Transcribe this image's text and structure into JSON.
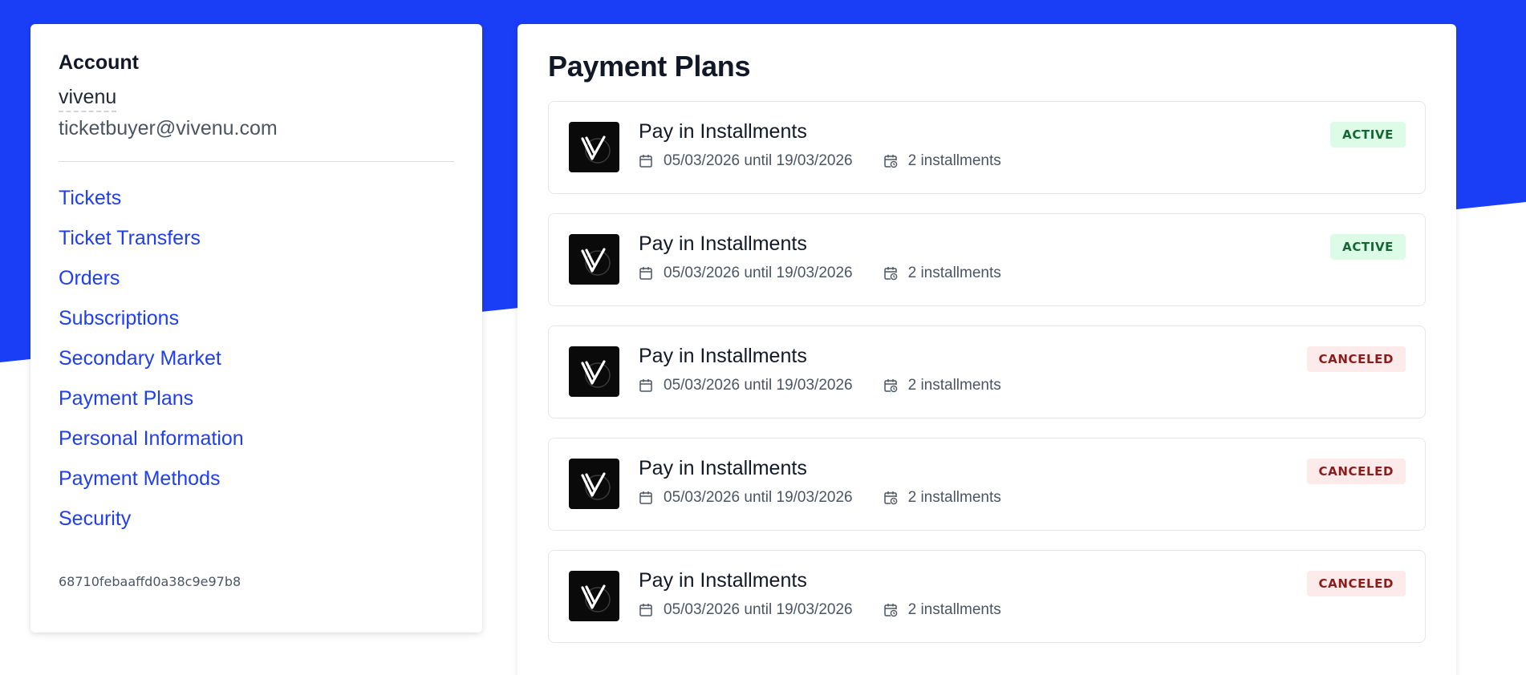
{
  "colors": {
    "brand_blue": "#1a3ef6",
    "link": "#1f3ef0",
    "active_bg": "#dcfce7",
    "active_text": "#166534",
    "canceled_bg": "#fdeaea",
    "canceled_text": "#8b1c1c"
  },
  "account": {
    "heading": "Account",
    "name": "vivenu",
    "email": "ticketbuyer@vivenu.com",
    "nav": [
      {
        "label": "Tickets"
      },
      {
        "label": "Ticket Transfers"
      },
      {
        "label": "Orders"
      },
      {
        "label": "Subscriptions"
      },
      {
        "label": "Secondary Market"
      },
      {
        "label": "Payment Plans"
      },
      {
        "label": "Personal Information"
      },
      {
        "label": "Payment Methods"
      },
      {
        "label": "Security"
      }
    ],
    "user_id": "68710febaaffd0a38c9e97b8"
  },
  "payment_plans": {
    "title": "Payment Plans",
    "plans": [
      {
        "name": "Pay in Installments",
        "dates": "05/03/2026 until 19/03/2026",
        "installments": "2 installments",
        "status": "ACTIVE",
        "status_type": "active"
      },
      {
        "name": "Pay in Installments",
        "dates": "05/03/2026 until 19/03/2026",
        "installments": "2 installments",
        "status": "ACTIVE",
        "status_type": "active"
      },
      {
        "name": "Pay in Installments",
        "dates": "05/03/2026 until 19/03/2026",
        "installments": "2 installments",
        "status": "CANCELED",
        "status_type": "canceled"
      },
      {
        "name": "Pay in Installments",
        "dates": "05/03/2026 until 19/03/2026",
        "installments": "2 installments",
        "status": "CANCELED",
        "status_type": "canceled"
      },
      {
        "name": "Pay in Installments",
        "dates": "05/03/2026 until 19/03/2026",
        "installments": "2 installments",
        "status": "CANCELED",
        "status_type": "canceled"
      }
    ],
    "icons": {
      "date": "calendar-icon",
      "installments": "calendar-clock-icon",
      "logo": "vivenu-logo"
    }
  }
}
